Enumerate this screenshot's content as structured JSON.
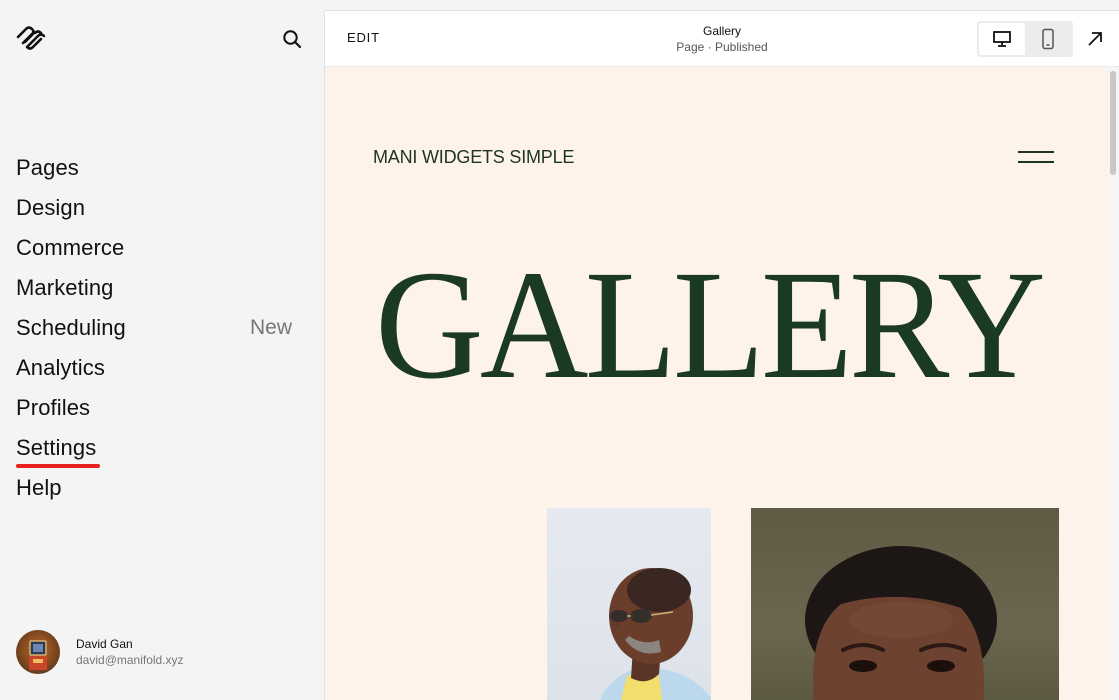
{
  "sidebar": {
    "logo": "squarespace-logo",
    "search_icon": "search-icon",
    "nav": [
      {
        "label": "Pages"
      },
      {
        "label": "Design"
      },
      {
        "label": "Commerce"
      },
      {
        "label": "Marketing"
      },
      {
        "label": "Scheduling",
        "badge": "New"
      },
      {
        "label": "Analytics"
      },
      {
        "label": "Profiles"
      },
      {
        "label": "Settings",
        "active": true
      },
      {
        "label": "Help"
      }
    ],
    "accent_color": "#e8231f",
    "user": {
      "name": "David Gan",
      "email": "david@manifold.xyz"
    }
  },
  "topbar": {
    "edit_label": "EDIT",
    "page_title": "Gallery",
    "page_status": "Page · Published",
    "device_desktop_icon": "desktop-icon",
    "device_mobile_icon": "mobile-icon",
    "active_device": "desktop",
    "expand_icon": "arrow-up-right-icon"
  },
  "preview": {
    "site_title": "MANI WIDGETS SIMPLE",
    "menu_icon": "hamburger-icon",
    "heading": "GALLERY",
    "background_color": "#fdf3ea",
    "text_color": "#1b3a22"
  }
}
